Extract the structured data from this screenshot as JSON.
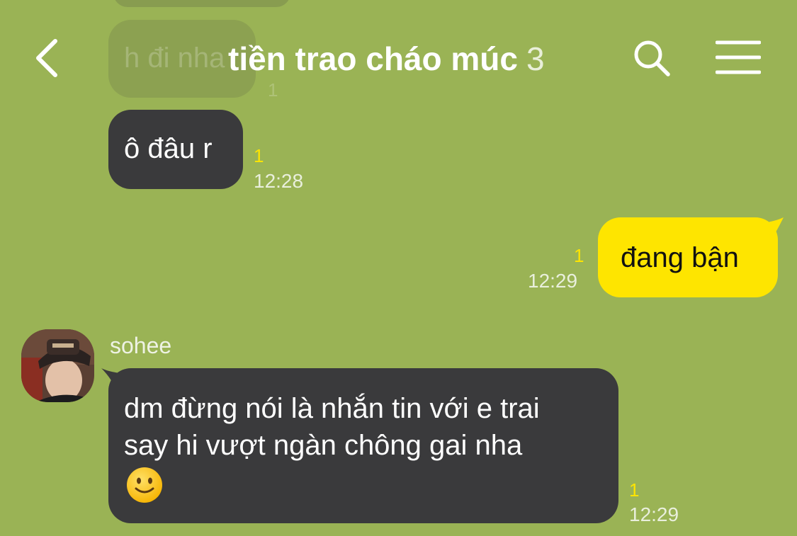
{
  "header": {
    "title": "tiền trao cháo múc",
    "member_count": "3",
    "back_icon": "chevron-left-icon",
    "search_icon": "search-icon",
    "menu_icon": "hamburger-menu-icon"
  },
  "previous_message": {
    "text": "h đi nha",
    "unread": "1"
  },
  "messages": [
    {
      "direction": "incoming",
      "text": "ô đâu r",
      "unread": "1",
      "time": "12:28"
    },
    {
      "direction": "outgoing",
      "text": "đang bận",
      "unread": "1",
      "time": "12:29"
    },
    {
      "direction": "incoming",
      "sender": "sohee",
      "lines": [
        "dm đừng nói là nhắn tin với e trai",
        "say hi vượt ngàn chông gai nha"
      ],
      "emoji": "slightly-smiling-face-emoji",
      "unread": "1",
      "time": "12:29"
    }
  ],
  "colors": {
    "background": "#9ab355",
    "incoming_bubble": "#3a3a3c",
    "outgoing_bubble": "#fee500",
    "unread_count": "#fee500"
  }
}
